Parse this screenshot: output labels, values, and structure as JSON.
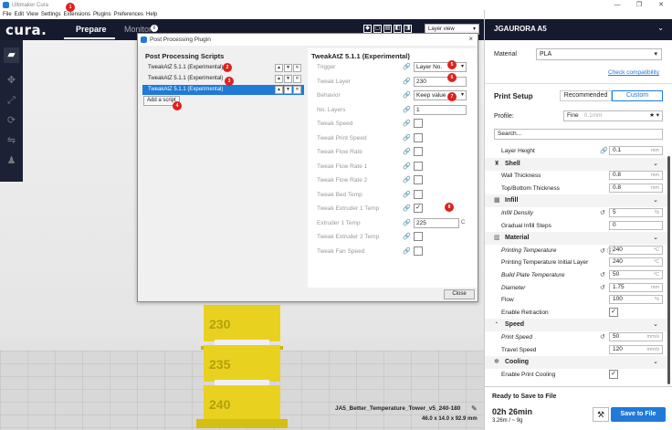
{
  "window": {
    "title": "Ultimaker Cura",
    "controls": [
      "—",
      "❐",
      "✕"
    ]
  },
  "menubar": [
    "File",
    "Edit",
    "View",
    "Settings",
    "Extensions",
    "Plugins",
    "Preferences",
    "Help"
  ],
  "markers": {
    "extensions": "1",
    "script1": "2",
    "script2": "3",
    "add_script": "4",
    "trigger": "5",
    "layer": "6",
    "behavior": "7",
    "temp": "8"
  },
  "header": {
    "logo": "cura.",
    "stages": [
      {
        "label": "Prepare",
        "active": true
      },
      {
        "label": "Monitor",
        "active": false
      }
    ],
    "view_select": "Layer view",
    "monitor_info_icon": "i"
  },
  "viewport": {
    "model_name": "JA5_Better_Temperature_Tower_v5_240-180",
    "model_dims": "46.0 x 14.0 x 92.9 mm",
    "tower_labels": [
      "230",
      "235",
      "240"
    ],
    "tower_color": "#e8d21f"
  },
  "dialog": {
    "title": "Post Processing Plugin",
    "scripts_heading": "Post Processing Scripts",
    "scripts": [
      {
        "name": "TweakAtZ 5.1.1 (Experimental)",
        "selected": false
      },
      {
        "name": "TweakAtZ 5.1.1 (Experimental)",
        "selected": false
      },
      {
        "name": "TweakAtZ 5.1.1 (Experimental)",
        "selected": true
      }
    ],
    "add_script": "Add a script",
    "settings_heading": "TweakAtZ 5.1.1 (Experimental)",
    "settings": [
      {
        "label": "Trigger",
        "type": "select",
        "value": "Layer No."
      },
      {
        "label": "Tweak Layer",
        "type": "text",
        "value": "230"
      },
      {
        "label": "Behavior",
        "type": "select",
        "value": "Keep value"
      },
      {
        "label": "No. Layers",
        "type": "text",
        "value": "1"
      },
      {
        "label": "Tweak Speed",
        "type": "check",
        "checked": false
      },
      {
        "label": "Tweak Print Speed",
        "type": "check",
        "checked": false
      },
      {
        "label": "Tweak Flow Rate",
        "type": "check",
        "checked": false
      },
      {
        "label": "Tweak Flow Rate 1",
        "type": "check",
        "checked": false
      },
      {
        "label": "Tweak Flow Rate 2",
        "type": "check",
        "checked": false
      },
      {
        "label": "Tweak Bed Temp",
        "type": "check",
        "checked": false
      },
      {
        "label": "Tweak Extruder 1 Temp",
        "type": "check",
        "checked": true
      },
      {
        "label": "Extruder 1 Temp",
        "type": "text",
        "value": "225",
        "unit": "C"
      },
      {
        "label": "Tweak Extruder 2 Temp",
        "type": "check",
        "checked": false
      },
      {
        "label": "Tweak Fan Speed",
        "type": "check",
        "checked": false
      }
    ],
    "close": "Close"
  },
  "rpanel": {
    "printer": "JGAURORA A5",
    "material_label": "Material",
    "material": "PLA",
    "compat_link": "Check compatibility",
    "print_setup": "Print Setup",
    "mode_recommended": "Recommended",
    "mode_custom": "Custom",
    "profile_label": "Profile:",
    "profile": "Fine",
    "profile_hint": "0.1mm",
    "search_placeholder": "Search...",
    "rows": [
      {
        "kind": "setting",
        "label": "Layer Height",
        "italic": false,
        "link": true,
        "value": "0.1",
        "unit": "mm"
      },
      {
        "kind": "cat",
        "label": "Shell",
        "icon": "♜"
      },
      {
        "kind": "setting",
        "label": "Wall Thickness",
        "value": "0.8",
        "unit": "mm"
      },
      {
        "kind": "setting",
        "label": "Top/Bottom Thickness",
        "value": "0.8",
        "unit": "mm"
      },
      {
        "kind": "cat",
        "label": "Infill",
        "icon": "▦"
      },
      {
        "kind": "setting",
        "label": "Infill Density",
        "italic": true,
        "reset": true,
        "value": "5",
        "unit": "%"
      },
      {
        "kind": "setting",
        "label": "Gradual Infill Steps",
        "value": "0",
        "unit": ""
      },
      {
        "kind": "cat",
        "label": "Material",
        "icon": "▥"
      },
      {
        "kind": "setting",
        "label": "Printing Temperature",
        "italic": true,
        "reset": true,
        "info": true,
        "value": "240",
        "unit": "°C"
      },
      {
        "kind": "setting",
        "label": "Printing Temperature Initial Layer",
        "value": "240",
        "unit": "°C"
      },
      {
        "kind": "setting",
        "label": "Build Plate Temperature",
        "italic": true,
        "link": true,
        "reset": true,
        "value": "50",
        "unit": "°C"
      },
      {
        "kind": "setting",
        "label": "Diameter",
        "italic": true,
        "reset": true,
        "value": "1.75",
        "unit": "mm"
      },
      {
        "kind": "setting",
        "label": "Flow",
        "value": "100",
        "unit": "%"
      },
      {
        "kind": "check",
        "label": "Enable Retraction",
        "checked": true
      },
      {
        "kind": "cat",
        "label": "Speed",
        "icon": "◔"
      },
      {
        "kind": "setting",
        "label": "Print Speed",
        "italic": true,
        "reset": true,
        "value": "50",
        "unit": "mm/s"
      },
      {
        "kind": "setting",
        "label": "Travel Speed",
        "value": "120",
        "unit": "mm/s"
      },
      {
        "kind": "cat",
        "label": "Cooling",
        "icon": "✻"
      },
      {
        "kind": "check",
        "label": "Enable Print Cooling",
        "checked": true
      }
    ],
    "ready": "Ready to Save to File",
    "time": "02h 26min",
    "amount": "3.26m / ~ 9g",
    "save": "Save to File"
  },
  "colors": {
    "accent": "#1f7ad8",
    "header": "#151a2e",
    "marker": "#e0201b"
  }
}
